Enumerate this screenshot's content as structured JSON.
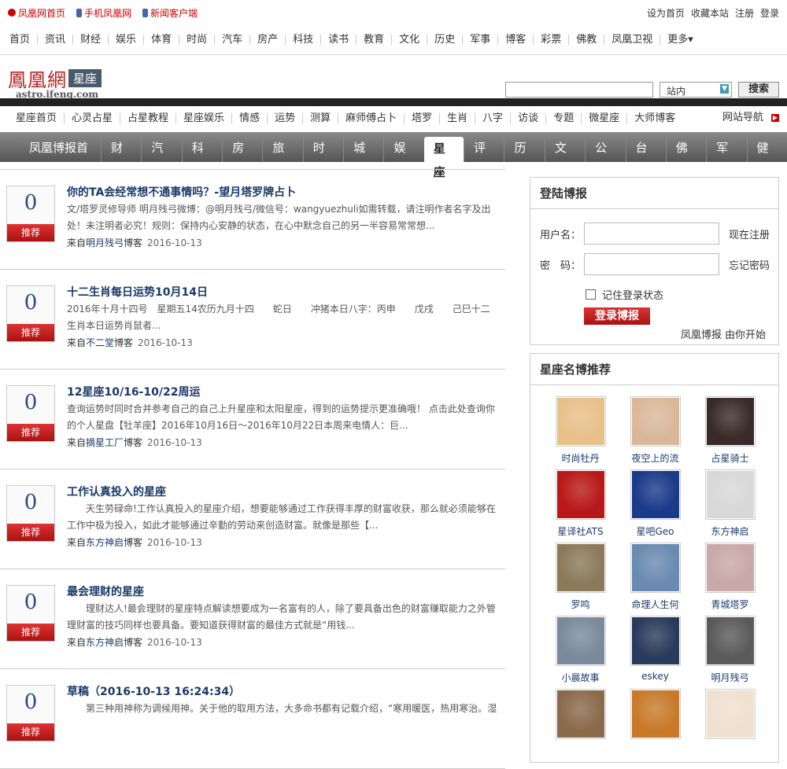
{
  "topbar": {
    "left": [
      {
        "label": "凤凰网首页",
        "icon": "ifeng-icon"
      },
      {
        "label": "手机凤凰网",
        "icon": "phone-icon"
      },
      {
        "label": "新闻客户端",
        "icon": "phone-icon"
      }
    ],
    "right": [
      "设为首页",
      "收藏本站",
      "注册",
      "登录"
    ]
  },
  "main_nav": [
    "首页",
    "资讯",
    "财经",
    "娱乐",
    "体育",
    "时尚",
    "汽车",
    "房产",
    "科技",
    "读书",
    "教育",
    "文化",
    "历史",
    "军事",
    "博客",
    "彩票",
    "佛教",
    "凤凰卫视",
    "更多▾"
  ],
  "logo": {
    "name": "鳳凰網",
    "section": "星座",
    "url": "astro.ifeng.com"
  },
  "search": {
    "placeholder": "",
    "scope": "站内",
    "button": "搜索"
  },
  "astro_nav": [
    "星座首页",
    "心灵占星",
    "占星教程",
    "星座娱乐",
    "情感",
    "运势",
    "测算",
    "麻师傅占卜",
    "塔罗",
    "生肖",
    "八字",
    "访谈",
    "专题",
    "微星座",
    "大师博客"
  ],
  "site_nav_label": "网站导航",
  "blog_nav": {
    "items": [
      "凤凰博报首页",
      "财经",
      "汽车",
      "科技",
      "房产",
      "旅游",
      "时尚",
      "城市",
      "娱乐",
      "星座",
      "评论",
      "历史",
      "文化",
      "公益",
      "台湾",
      "佛教",
      "军事",
      "健康"
    ],
    "active": "星座"
  },
  "posts": [
    {
      "votes": "0",
      "vote_label": "推荐",
      "title": "你的TA会经常想不通事情吗？-望月塔罗牌占卜",
      "desc": "文/塔罗灵修导师 明月残弓微博：@明月残弓/微信号：wangyuezhuli如需转载，请注明作者名字及出处！未注明者必究！规则：保持内心安静的状态，在心中默念自己的另一半容易常常想...",
      "source_prefix": "来自",
      "author": "明月残弓",
      "source_suffix": "博客",
      "date": "2016-10-13"
    },
    {
      "votes": "0",
      "vote_label": "推荐",
      "title": "十二生肖每日运势10月14日",
      "desc": "2016年十月十四号　星期五14农历九月十四　　蛇日　　冲猪本日八字：丙申　　戊戌　　己巳十二生肖本日运势肖鼠者...",
      "source_prefix": "来自",
      "author": "不二堂",
      "source_suffix": "博客",
      "date": "2016-10-13"
    },
    {
      "votes": "0",
      "vote_label": "推荐",
      "title": "12星座10/16-10/22周运",
      "desc": "查询运势时同时合并参考自己的自己上升星座和太阳星座，得到的运势提示更准确哦！ 点击此处查询你的个人星盘【牡羊座】2016年10月16日～2016年10月22日本周来电情人：巨...",
      "source_prefix": "来自",
      "author": "摘星工厂",
      "source_suffix": "博客",
      "date": "2016-10-13"
    },
    {
      "votes": "0",
      "vote_label": "推荐",
      "title": "工作认真投入的星座",
      "desc": "　　天生劳碌命!工作认真投入的星座介绍，想要能够通过工作获得丰厚的财富收获，那么就必须能够在工作中极为投入，如此才能够通过辛勤的劳动来创造财富。就像是那些【...",
      "source_prefix": "来自",
      "author": "东方神启",
      "source_suffix": "博客",
      "date": "2016-10-13"
    },
    {
      "votes": "0",
      "vote_label": "推荐",
      "title": "最会理财的星座",
      "desc": "　　理财达人!最会理财的星座特点解读想要成为一名富有的人，除了要具备出色的财富赚取能力之外管理财富的技巧同样也要具备。要知道获得财富的最佳方式就是“用钱...",
      "source_prefix": "来自",
      "author": "东方神启",
      "source_suffix": "博客",
      "date": "2016-10-13"
    },
    {
      "votes": "0",
      "vote_label": "推荐",
      "title": "草稿（2016-10-13 16:24:34）",
      "desc": "　　第三种用神称为调候用神。关于他的取用方法，大多命书都有记载介绍，“寒用暖医，热用寒治。湿",
      "source_prefix": "来自",
      "author": "",
      "source_suffix": "",
      "date": ""
    }
  ],
  "login": {
    "title": "登陆博报",
    "username_label": "用户名：",
    "password_label": "密　码：",
    "register_link": "现在注册",
    "forgot_link": "忘记密码",
    "remember_label": "记住登录状态",
    "button": "登录博报",
    "footer": "凤凰博报 由你开始"
  },
  "recommend": {
    "title": "星座名博推荐",
    "bloggers": [
      {
        "name": "时尚牡丹",
        "color": "#e8c08a"
      },
      {
        "name": "夜空上的流",
        "color": "#d9b89a"
      },
      {
        "name": "占星骑士",
        "color": "#3a2a2a"
      },
      {
        "name": "星译社ATS",
        "color": "#b81818"
      },
      {
        "name": "星吧Geo",
        "color": "#1a3a8a"
      },
      {
        "name": "东方神启",
        "color": "#d8d8d8"
      },
      {
        "name": "罗鸣",
        "color": "#8a7a5a"
      },
      {
        "name": "命理人生何",
        "color": "#6a8ab0"
      },
      {
        "name": "青城塔罗",
        "color": "#c8a8a8"
      },
      {
        "name": "小晨故事",
        "color": "#7a8a9a"
      },
      {
        "name": "eskey",
        "color": "#2a3a5a"
      },
      {
        "name": "明月残弓",
        "color": "#5a5a5a"
      },
      {
        "name": "",
        "color": "#8a6a4a"
      },
      {
        "name": "",
        "color": "#c87a2a"
      },
      {
        "name": "",
        "color": "#f0e0d0"
      }
    ]
  }
}
